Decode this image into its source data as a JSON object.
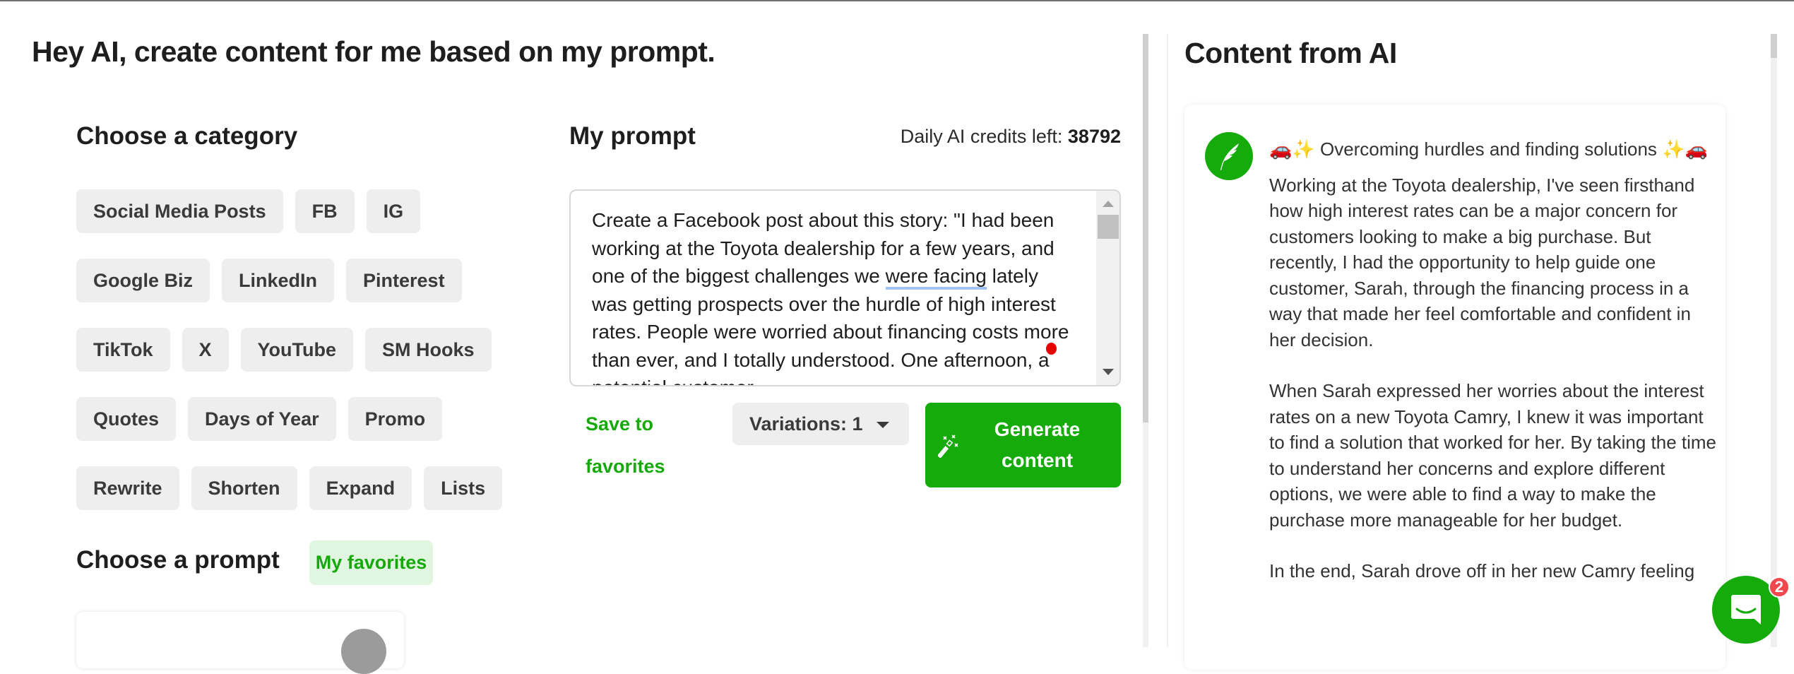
{
  "header": {
    "title": "Hey AI, create content for me based on my prompt."
  },
  "category": {
    "heading": "Choose a category",
    "chips": [
      "Social Media Posts",
      "FB",
      "IG",
      "Google Biz",
      "LinkedIn",
      "Pinterest",
      "TikTok",
      "X",
      "YouTube",
      "SM Hooks",
      "Quotes",
      "Days of Year",
      "Promo",
      "Rewrite",
      "Shorten",
      "Expand",
      "Lists"
    ]
  },
  "prompt_picker": {
    "heading": "Choose a prompt",
    "favorites_label": "My favorites"
  },
  "prompt": {
    "heading": "My prompt",
    "credits_label": "Daily AI credits left:",
    "credits_value": "38792",
    "text_before": "Create a Facebook post about this story: \"I had been working at the Toyota dealership for a few years, and one of the biggest challenges we ",
    "text_spell": "were facing",
    "text_after": " lately was getting prospects over the hurdle of high interest rates. People were worried about financing costs more than ever, and I totally understood. One afternoon, a potential customer",
    "save_label": "Save to favorites",
    "variations_label": "Variations: 1",
    "generate_label": "Generate content"
  },
  "output": {
    "heading": "Content from AI",
    "headline": "🚗✨ Overcoming hurdles and finding solutions ✨🚗",
    "paragraphs": [
      "Working at the Toyota dealership, I've seen firsthand how high interest rates can be a major concern for customers looking to make a big purchase. But recently, I had the opportunity to help guide one customer, Sarah, through the financing process in a way that made her feel comfortable and confident in her decision.",
      "When Sarah expressed her worries about the interest rates on a new Toyota Camry, I knew it was important to find a solution that worked for her. By taking the time to understand her concerns and explore different options, we were able to find a way to make the purchase more manageable for her budget.",
      "In the end, Sarah drove off in her new Camry feeling"
    ]
  },
  "chat": {
    "badge_count": "2"
  },
  "colors": {
    "brand_green": "#14ab0b",
    "chip_bg": "#eeeeee",
    "fav_bg": "#e1f6e1",
    "badge_red": "#f0484e"
  }
}
